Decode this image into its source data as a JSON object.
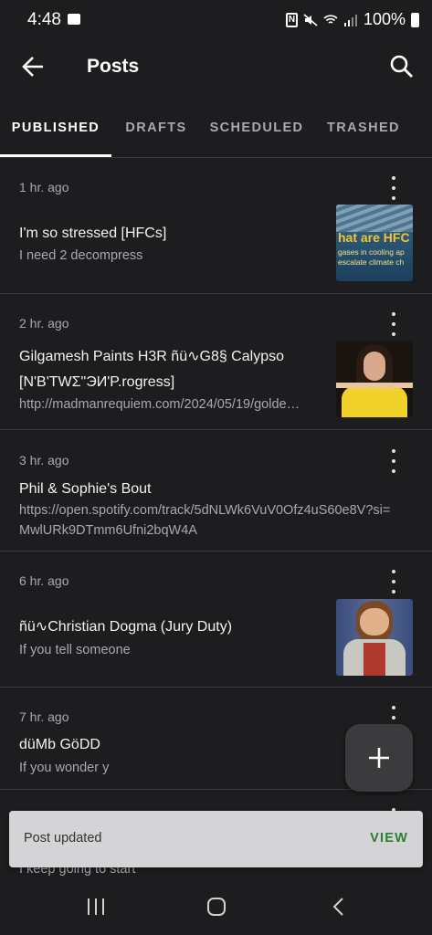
{
  "status_bar": {
    "time": "4:48",
    "battery": "100%",
    "icons": [
      "photo-icon",
      "nfc-icon",
      "mute-icon",
      "wifi-icon",
      "signal-icon",
      "battery-icon"
    ]
  },
  "app_bar": {
    "title": "Posts",
    "back_icon": "arrow-back-icon",
    "search_icon": "search-icon"
  },
  "tabs": [
    {
      "label": "PUBLISHED",
      "active": true
    },
    {
      "label": "DRAFTS",
      "active": false
    },
    {
      "label": "SCHEDULED",
      "active": false
    },
    {
      "label": "TRASHED",
      "active": false
    }
  ],
  "posts": [
    {
      "time": "1 hr. ago",
      "title": "I'm so stressed [HFCs]",
      "excerpt": "I need 2 decompress",
      "thumb_text": "hat are HFC",
      "thumb_sub": "gases in cooling ap escalate climate ch"
    },
    {
      "time": "2 hr. ago",
      "title": "Gilgamesh Paints H3R ñü∿G8§ Calypso [N'B'TWΣ\"ЭИ'P.rogress]",
      "excerpt": "http://madmanrequiem.com/2024/05/19/golde…"
    },
    {
      "time": "3 hr. ago",
      "title": "Phil & Sophie's Bout",
      "excerpt": "https://open.spotify.com/track/5dNLWk6VuV0Ofz4uS60e8V?si=MwlURk9DTmm6Ufni2bqW4A"
    },
    {
      "time": "6 hr. ago",
      "title": "ñü∿Christian Dogma (Jury Duty)",
      "excerpt": "If you tell someone"
    },
    {
      "time": "7 hr. ago",
      "title": "düMb GöDD",
      "excerpt": "If you wonder y"
    },
    {
      "time": "",
      "title": "",
      "excerpt": "I keep going to start"
    }
  ],
  "snackbar": {
    "message": "Post updated",
    "action": "VIEW"
  },
  "colors": {
    "background": "#1d1d1f",
    "divider": "#3a3a3c",
    "snackbar_action": "#2e7d32"
  }
}
